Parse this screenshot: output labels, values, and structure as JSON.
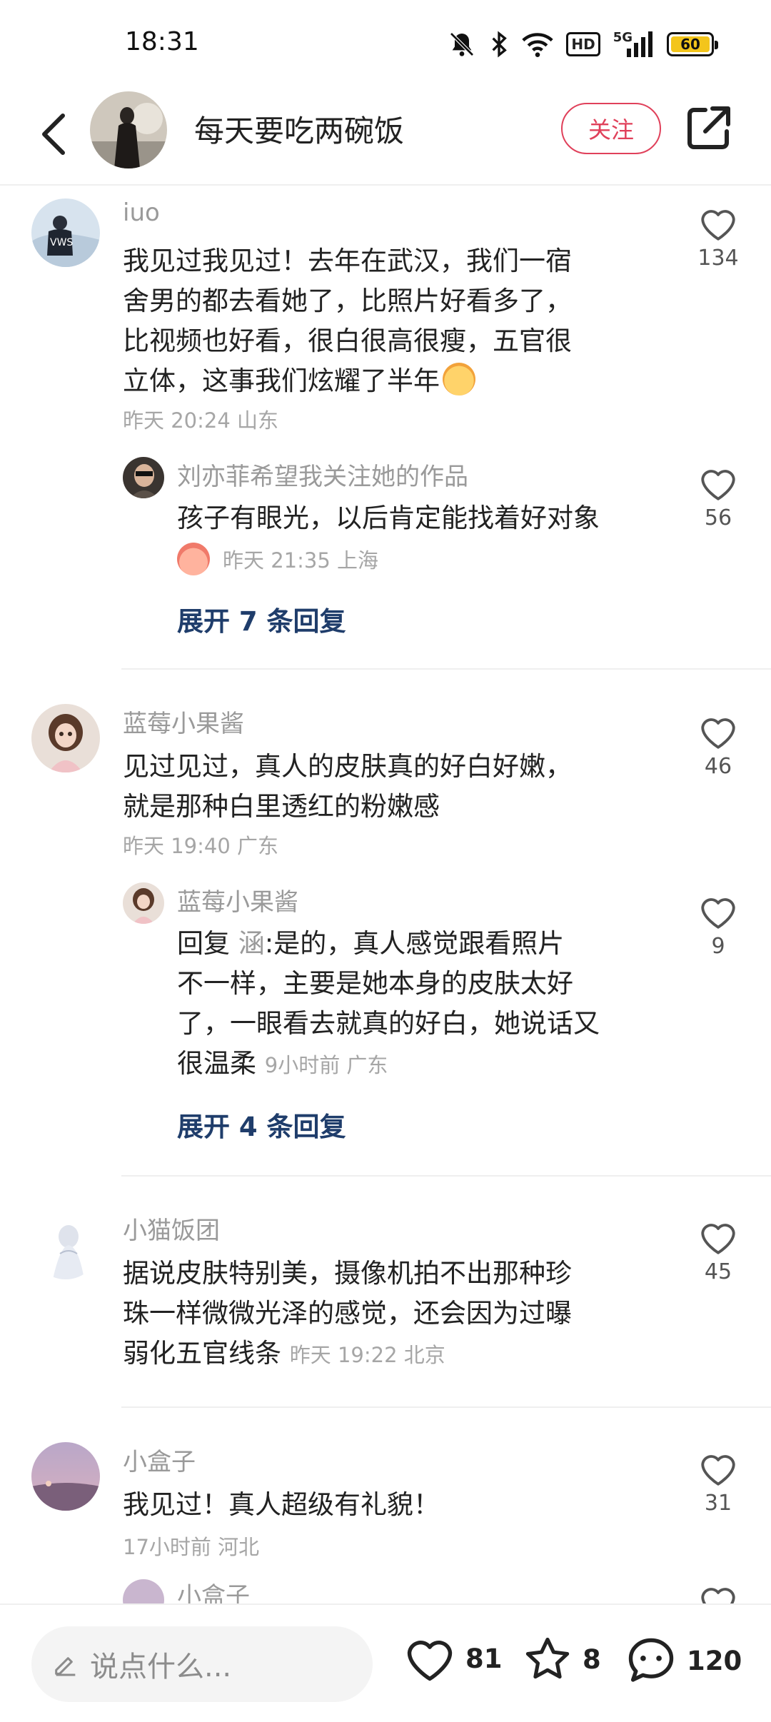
{
  "status_bar": {
    "time": "18:31",
    "network": "5G",
    "hd": "HD",
    "battery": "60"
  },
  "header": {
    "title": "每天要吃两碗饭",
    "follow_label": "关注"
  },
  "comments": [
    {
      "user": "iuo",
      "text_lines": [
        "我见过我见过！去年在武汉，我们一宿",
        "舍男的都去看她了，比照片好看多了，",
        "比视频也好看，很白很高很瘦，五官很",
        "立体，这事我们炫耀了半年"
      ],
      "meta": "昨天 20:24 山东",
      "likes": "134",
      "reply": {
        "user": "刘亦菲希望我关注她的作品",
        "text": "孩子有眼光，以后肯定能找着好对象",
        "meta": "昨天 21:35 上海",
        "likes": "56"
      },
      "expand": "展开 7 条回复"
    },
    {
      "user": "蓝莓小果酱",
      "text_lines": [
        "见过见过，真人的皮肤真的好白好嫩，",
        "就是那种白里透红的粉嫩感"
      ],
      "meta": "昨天 19:40 广东",
      "likes": "46",
      "reply": {
        "user": "蓝莓小果酱",
        "reply_prefix": "回复",
        "reply_to": "涵",
        "text_lines": [
          ":是的，真人感觉跟看照片",
          "不一样，主要是她本身的皮肤太好",
          "了，一眼看去就真的好白，她说话又",
          "很温柔"
        ],
        "meta": "9小时前  广东",
        "likes": "9"
      },
      "expand": "展开 4 条回复"
    },
    {
      "user": "小猫饭团",
      "text_lines": [
        "据说皮肤特别美，摄像机拍不出那种珍",
        "珠一样微微光泽的感觉，还会因为过曝",
        "弱化五官线条"
      ],
      "meta": "昨天 19:22 北京",
      "likes": "45"
    },
    {
      "user": "小盒子",
      "text_lines": [
        "我见过！真人超级有礼貌！"
      ],
      "meta": "17小时前  河北",
      "likes": "31",
      "partial_reply_user": "小盒子"
    }
  ],
  "bottom_bar": {
    "input_placeholder": "说点什么...",
    "likes": "81",
    "stars": "8",
    "comments": "120"
  },
  "colors": {
    "accent": "#e0405a",
    "expand_link": "#1f3d6b",
    "meta": "#a6a6a6"
  }
}
